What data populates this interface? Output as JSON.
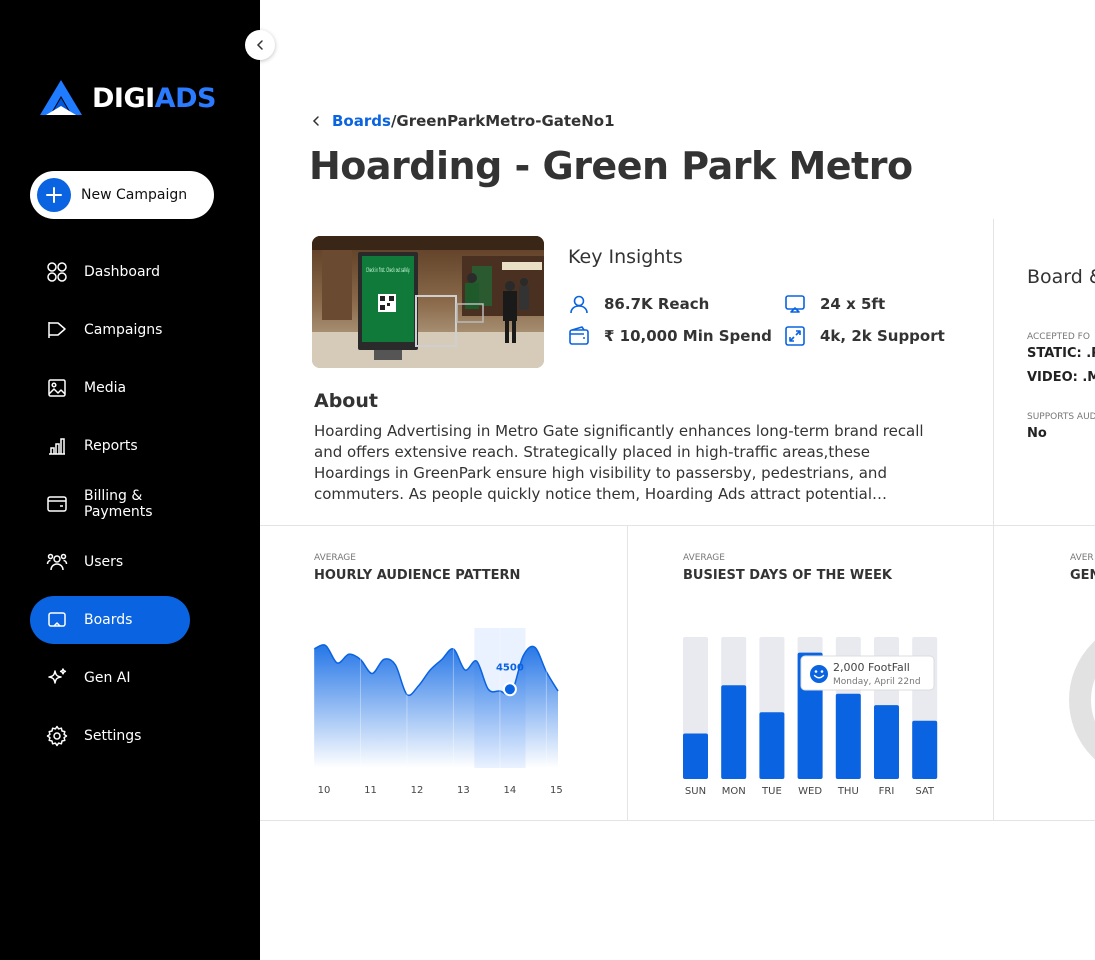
{
  "brand": {
    "name_white": "DIGI",
    "name_blue": "ADS",
    "accent": "#0a63e0"
  },
  "sidebar": {
    "new_campaign_label": "New Campaign",
    "items": [
      {
        "label": "Dashboard",
        "icon": "dashboard-icon"
      },
      {
        "label": "Campaigns",
        "icon": "campaigns-icon"
      },
      {
        "label": "Media",
        "icon": "media-icon"
      },
      {
        "label": "Reports",
        "icon": "reports-icon"
      },
      {
        "label": "Billing & Payments",
        "icon": "billing-icon"
      },
      {
        "label": "Users",
        "icon": "users-icon"
      },
      {
        "label": "Boards",
        "icon": "boards-icon",
        "active": true
      },
      {
        "label": "Gen AI",
        "icon": "sparkle-icon"
      },
      {
        "label": "Settings",
        "icon": "gear-icon"
      }
    ]
  },
  "breadcrumb": {
    "link": "Boards",
    "separator": "/",
    "current": "GreenParkMetro-GateNo1"
  },
  "page_title": "Hoarding - Green Park Metro",
  "hero_screen_text": "Check in first. Check out safely.",
  "key_insights": {
    "title": "Key Insights",
    "reach": "86.7K Reach",
    "size": "24 x 5ft",
    "min_spend": "₹ 10,000 Min Spend",
    "support": "4k, 2k Support"
  },
  "about": {
    "title": "About",
    "text": "Hoarding Advertising in Metro Gate significantly enhances long-term brand recall and offers extensive reach. Strategically placed in high-traffic areas,these Hoardings in GreenPark ensure high visibility to passersby, pedestrians, and commuters. As people quickly notice them, Hoarding Ads attract potential customers and maintain brand awareness."
  },
  "board_details": {
    "title": "Board &",
    "accepted_label": "ACCEPTED FO",
    "static_line": "STATIC: .P",
    "video_line": "VIDEO: .M",
    "audio_label": "SUPPORTS AUD",
    "audio_value": "No"
  },
  "hourly_card": {
    "label": "AVERAGE",
    "title": "HOURLY AUDIENCE PATTERN",
    "highlight_value": "4500"
  },
  "busiest_card": {
    "label": "AVERAGE",
    "title": "BUSIEST DAYS OF THE WEEK",
    "tooltip_value": "2,000 FootFall",
    "tooltip_date": "Monday, April 22nd"
  },
  "third_card": {
    "label": "AVER",
    "title": "GEN"
  },
  "chart_data": [
    {
      "type": "area",
      "title": "HOURLY AUDIENCE PATTERN",
      "categories": [
        "10",
        "11",
        "12",
        "13",
        "14",
        "15"
      ],
      "x": [
        10,
        10.25,
        10.5,
        10.75,
        11,
        11.25,
        11.5,
        11.75,
        12,
        12.25,
        12.5,
        12.75,
        13,
        13.25,
        13.5,
        13.75,
        14,
        14.25,
        14.5,
        14.75,
        15,
        15.25
      ],
      "values": [
        6800,
        7000,
        6000,
        6500,
        6200,
        5400,
        6200,
        5900,
        4200,
        4700,
        5600,
        6200,
        6800,
        5600,
        6100,
        4500,
        4400,
        4300,
        6400,
        6900,
        5500,
        4400
      ],
      "highlight": {
        "x": 14,
        "value": 4500
      },
      "ylim": [
        0,
        8000
      ]
    },
    {
      "type": "bar",
      "title": "BUSIEST DAYS OF THE WEEK",
      "categories": [
        "SUN",
        "MON",
        "TUE",
        "WED",
        "THU",
        "FRI",
        "SAT"
      ],
      "values": [
        32,
        66,
        47,
        89,
        60,
        52,
        41
      ],
      "ylim": [
        0,
        100
      ],
      "color": "#0a63e0",
      "track_color": "#e8eaf0"
    }
  ]
}
